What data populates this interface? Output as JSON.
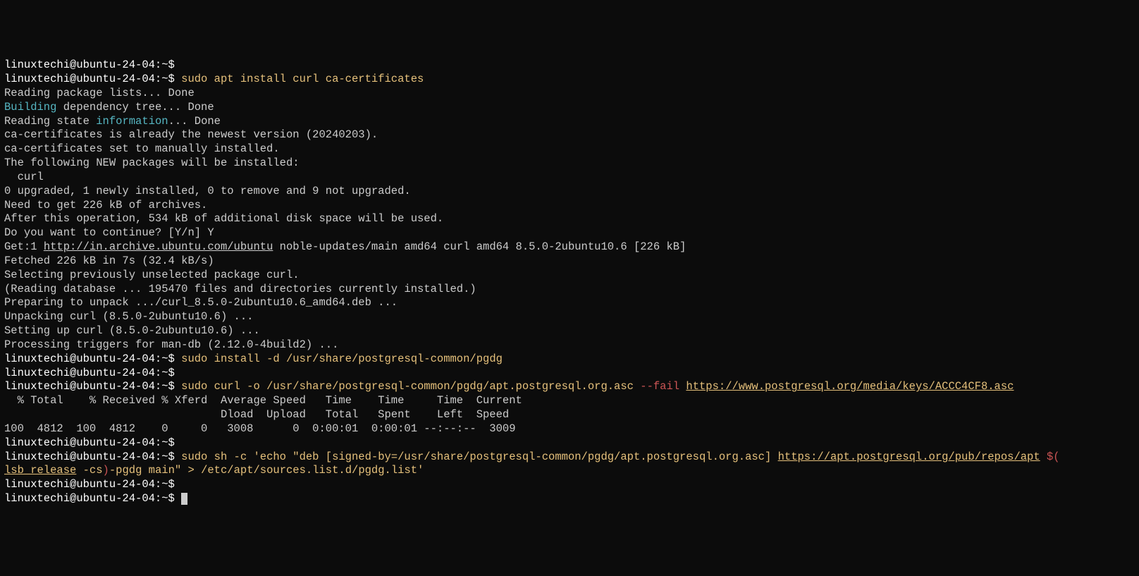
{
  "prompt": "linuxtechi@ubuntu-24-04:~$",
  "lines": [
    {
      "type": "prompt_only"
    },
    {
      "type": "prompt_cmd",
      "parts": [
        {
          "cls": "cmd-yellow",
          "txt": " sudo apt install curl ca-certificates"
        }
      ]
    },
    {
      "type": "output",
      "txt": "Reading package lists... Done"
    },
    {
      "type": "output_mixed",
      "parts": [
        {
          "cls": "cmd-cyan",
          "txt": "Building"
        },
        {
          "cls": "output",
          "txt": " dependency tree... Done"
        }
      ]
    },
    {
      "type": "output_mixed",
      "parts": [
        {
          "cls": "output",
          "txt": "Reading state "
        },
        {
          "cls": "cmd-cyan",
          "txt": "information"
        },
        {
          "cls": "output",
          "txt": "... Done"
        }
      ]
    },
    {
      "type": "output",
      "txt": "ca-certificates is already the newest version (20240203)."
    },
    {
      "type": "output",
      "txt": "ca-certificates set to manually installed."
    },
    {
      "type": "output",
      "txt": "The following NEW packages will be installed:"
    },
    {
      "type": "output",
      "txt": "  curl"
    },
    {
      "type": "output",
      "txt": "0 upgraded, 1 newly installed, 0 to remove and 9 not upgraded."
    },
    {
      "type": "output",
      "txt": "Need to get 226 kB of archives."
    },
    {
      "type": "output",
      "txt": "After this operation, 534 kB of additional disk space will be used."
    },
    {
      "type": "output",
      "txt": "Do you want to continue? [Y/n] Y"
    },
    {
      "type": "output_mixed",
      "parts": [
        {
          "cls": "output",
          "txt": "Get:1 "
        },
        {
          "cls": "output underline",
          "txt": "http://in.archive.ubuntu.com/ubuntu"
        },
        {
          "cls": "output",
          "txt": " noble-updates/main amd64 curl amd64 8.5.0-2ubuntu10.6 [226 kB]"
        }
      ]
    },
    {
      "type": "output",
      "txt": "Fetched 226 kB in 7s (32.4 kB/s)"
    },
    {
      "type": "output",
      "txt": "Selecting previously unselected package curl."
    },
    {
      "type": "output",
      "txt": "(Reading database ... 195470 files and directories currently installed.)"
    },
    {
      "type": "output",
      "txt": "Preparing to unpack .../curl_8.5.0-2ubuntu10.6_amd64.deb ..."
    },
    {
      "type": "output",
      "txt": "Unpacking curl (8.5.0-2ubuntu10.6) ..."
    },
    {
      "type": "output",
      "txt": "Setting up curl (8.5.0-2ubuntu10.6) ..."
    },
    {
      "type": "output",
      "txt": "Processing triggers for man-db (2.12.0-4build2) ..."
    },
    {
      "type": "prompt_cmd",
      "parts": [
        {
          "cls": "cmd-yellow",
          "txt": " sudo install -d /usr/share/postgresql-common/pgdg"
        }
      ]
    },
    {
      "type": "prompt_only"
    },
    {
      "type": "prompt_cmd",
      "parts": [
        {
          "cls": "cmd-yellow",
          "txt": " sudo curl -o /usr/share/postgresql-common/pgdg/apt.postgresql.org.asc "
        },
        {
          "cls": "cmd-darkred",
          "txt": "--fail"
        },
        {
          "cls": "cmd-yellow",
          "txt": " "
        },
        {
          "cls": "cmd-yellow underline",
          "txt": "https://www.postgresql.org/media/keys/ACCC4CF8.asc"
        }
      ]
    },
    {
      "type": "output",
      "txt": "  % Total    % Received % Xferd  Average Speed   Time    Time     Time  Current"
    },
    {
      "type": "output",
      "txt": "                                 Dload  Upload   Total   Spent    Left  Speed"
    },
    {
      "type": "output",
      "txt": "100  4812  100  4812    0     0   3008      0  0:00:01  0:00:01 --:--:--  3009"
    },
    {
      "type": "prompt_only"
    },
    {
      "type": "prompt_cmd",
      "parts": [
        {
          "cls": "cmd-yellow",
          "txt": " sudo sh -c 'echo \"deb [signed-by=/usr/share/postgresql-common/pgdg/apt.postgresql.org.asc] "
        },
        {
          "cls": "cmd-yellow underline",
          "txt": "https://apt.postgresql.org/pub/repos/apt"
        },
        {
          "cls": "cmd-yellow",
          "txt": " "
        },
        {
          "cls": "cmd-darkred",
          "txt": "$("
        }
      ]
    },
    {
      "type": "output_mixed",
      "parts": [
        {
          "cls": "cmd-yellow underline",
          "txt": "lsb_release"
        },
        {
          "cls": "cmd-yellow",
          "txt": " -cs"
        },
        {
          "cls": "cmd-darkred",
          "txt": ")"
        },
        {
          "cls": "cmd-yellow",
          "txt": "-pgdg main\" > /etc/apt/sources.list.d/pgdg.list'"
        }
      ]
    },
    {
      "type": "prompt_only"
    },
    {
      "type": "prompt_cursor"
    }
  ]
}
